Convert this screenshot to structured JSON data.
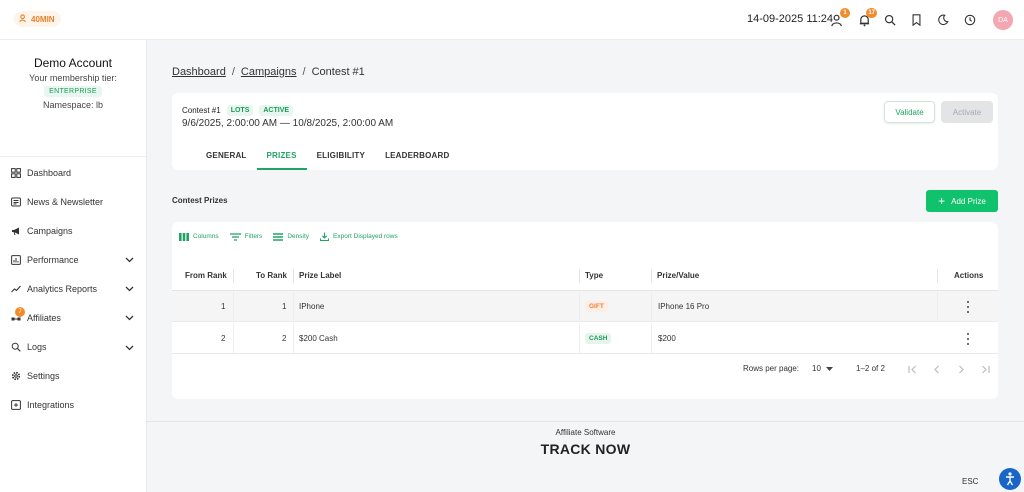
{
  "topbar": {
    "timer_label": "40MIN",
    "datetime": "14-09-2025 11:24",
    "notif_count_users": "1",
    "notif_count_bell": "17",
    "avatar_initials": "DA"
  },
  "sidebar": {
    "account_name": "Demo Account",
    "tier_text": "Your membership tier:",
    "tier_badge": "ENTERPRISE",
    "namespace": "Namespace: lb",
    "items": [
      {
        "label": "Dashboard",
        "icon": "dashboard-icon"
      },
      {
        "label": "News & Newsletter",
        "icon": "newspaper-icon"
      },
      {
        "label": "Campaigns",
        "icon": "megaphone-icon"
      },
      {
        "label": "Performance",
        "icon": "chart-box-icon",
        "expandable": true
      },
      {
        "label": "Analytics Reports",
        "icon": "trend-icon",
        "expandable": true
      },
      {
        "label": "Affiliates",
        "icon": "people-icon",
        "expandable": true,
        "badge": "7"
      },
      {
        "label": "Logs",
        "icon": "search-icon",
        "expandable": true
      },
      {
        "label": "Settings",
        "icon": "gear-icon"
      },
      {
        "label": "Integrations",
        "icon": "integrations-icon"
      }
    ]
  },
  "breadcrumb": {
    "items": [
      "Dashboard",
      "Campaigns",
      "Contest #1"
    ],
    "separator": "/"
  },
  "contest": {
    "title": "Contest #1",
    "chip_type": "LOTS",
    "chip_status": "ACTIVE",
    "dates": "9/6/2025, 2:00:00 AM — 10/8/2025, 2:00:00 AM",
    "validate_label": "Validate",
    "activate_label": "Activate",
    "tabs": [
      "GENERAL",
      "PRIZES",
      "ELIGIBILITY",
      "LEADERBOARD"
    ],
    "active_tab": "PRIZES"
  },
  "prizes": {
    "section_title": "Contest Prizes",
    "add_label": "Add Prize",
    "toolbar": [
      "Columns",
      "Filters",
      "Density",
      "Export Displayed rows"
    ],
    "columns": [
      "From Rank",
      "To Rank",
      "Prize Label",
      "Type",
      "Prize/Value",
      "Actions"
    ],
    "rows": [
      {
        "from": "1",
        "to": "1",
        "label": "IPhone",
        "type": "GIFT",
        "value": "IPhone 16 Pro"
      },
      {
        "from": "2",
        "to": "2",
        "label": "$200 Cash",
        "type": "CASH",
        "value": "$200"
      }
    ],
    "pagination": {
      "rows_per_page_label": "Rows per page:",
      "rows_per_page": "10",
      "range": "1–2 of 2"
    }
  },
  "footer": {
    "caption": "Affiliate Software",
    "brand": "TRACK NOW",
    "esc_label": "ESC"
  },
  "colors": {
    "accent": "#10c26b",
    "accent_text": "#1fa463",
    "warning": "#f08c2b"
  }
}
